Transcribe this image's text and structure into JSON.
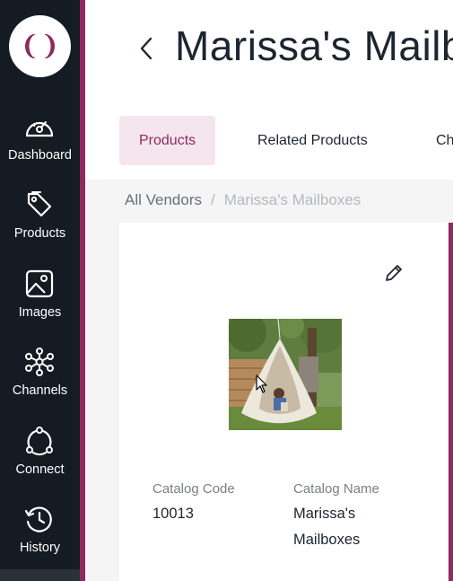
{
  "sidebar": {
    "items": [
      {
        "label": "Dashboard",
        "icon": "dashboard-gauge-icon"
      },
      {
        "label": "Products",
        "icon": "tag-icon"
      },
      {
        "label": "Images",
        "icon": "image-icon"
      },
      {
        "label": "Channels",
        "icon": "network-icon"
      },
      {
        "label": "Connect",
        "icon": "connect-cycle-icon"
      },
      {
        "label": "History",
        "icon": "history-clock-icon"
      }
    ],
    "accent_color": "#8e2a5c"
  },
  "header": {
    "title": "Marissa's Mailboxes",
    "tabs": [
      {
        "label": "Products",
        "active": true
      },
      {
        "label": "Related Products",
        "active": false
      },
      {
        "label": "Channels",
        "active": false
      }
    ]
  },
  "breadcrumb": {
    "root": "All Vendors",
    "separator": "/",
    "current": "Marissa's Mailboxes"
  },
  "card": {
    "fields": [
      {
        "label": "Catalog Code",
        "value": "10013"
      },
      {
        "label": "Catalog Name",
        "value": "Marissa's Mailboxes"
      }
    ]
  }
}
